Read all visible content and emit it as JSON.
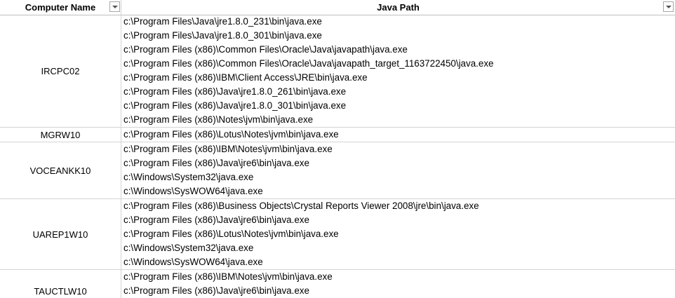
{
  "columns": {
    "computer_name": "Computer Name",
    "java_path": "Java Path"
  },
  "groups": [
    {
      "name": "IRCPC02",
      "paths": [
        "c:\\Program Files\\Java\\jre1.8.0_231\\bin\\java.exe",
        "c:\\Program Files\\Java\\jre1.8.0_301\\bin\\java.exe",
        "c:\\Program Files (x86)\\Common Files\\Oracle\\Java\\javapath\\java.exe",
        "c:\\Program Files (x86)\\Common Files\\Oracle\\Java\\javapath_target_1163722450\\java.exe",
        "c:\\Program Files (x86)\\IBM\\Client Access\\JRE\\bin\\java.exe",
        "c:\\Program Files (x86)\\Java\\jre1.8.0_261\\bin\\java.exe",
        "c:\\Program Files (x86)\\Java\\jre1.8.0_301\\bin\\java.exe",
        "c:\\Program Files (x86)\\Notes\\jvm\\bin\\java.exe"
      ]
    },
    {
      "name": "MGRW10",
      "paths": [
        "c:\\Program Files (x86)\\Lotus\\Notes\\jvm\\bin\\java.exe"
      ]
    },
    {
      "name": "VOCEANKK10",
      "paths": [
        "c:\\Program Files (x86)\\IBM\\Notes\\jvm\\bin\\java.exe",
        "c:\\Program Files (x86)\\Java\\jre6\\bin\\java.exe",
        "c:\\Windows\\System32\\java.exe",
        "c:\\Windows\\SysWOW64\\java.exe"
      ]
    },
    {
      "name": "UAREP1W10",
      "paths": [
        "c:\\Program Files (x86)\\Business Objects\\Crystal Reports Viewer 2008\\jre\\bin\\java.exe",
        "c:\\Program Files (x86)\\Java\\jre6\\bin\\java.exe",
        "c:\\Program Files (x86)\\Lotus\\Notes\\jvm\\bin\\java.exe",
        "c:\\Windows\\System32\\java.exe",
        "c:\\Windows\\SysWOW64\\java.exe"
      ]
    },
    {
      "name": "TAUCTLW10",
      "paths": [
        "c:\\Program Files (x86)\\IBM\\Notes\\jvm\\bin\\java.exe",
        "c:\\Program Files (x86)\\Java\\jre6\\bin\\java.exe"
      ]
    }
  ]
}
